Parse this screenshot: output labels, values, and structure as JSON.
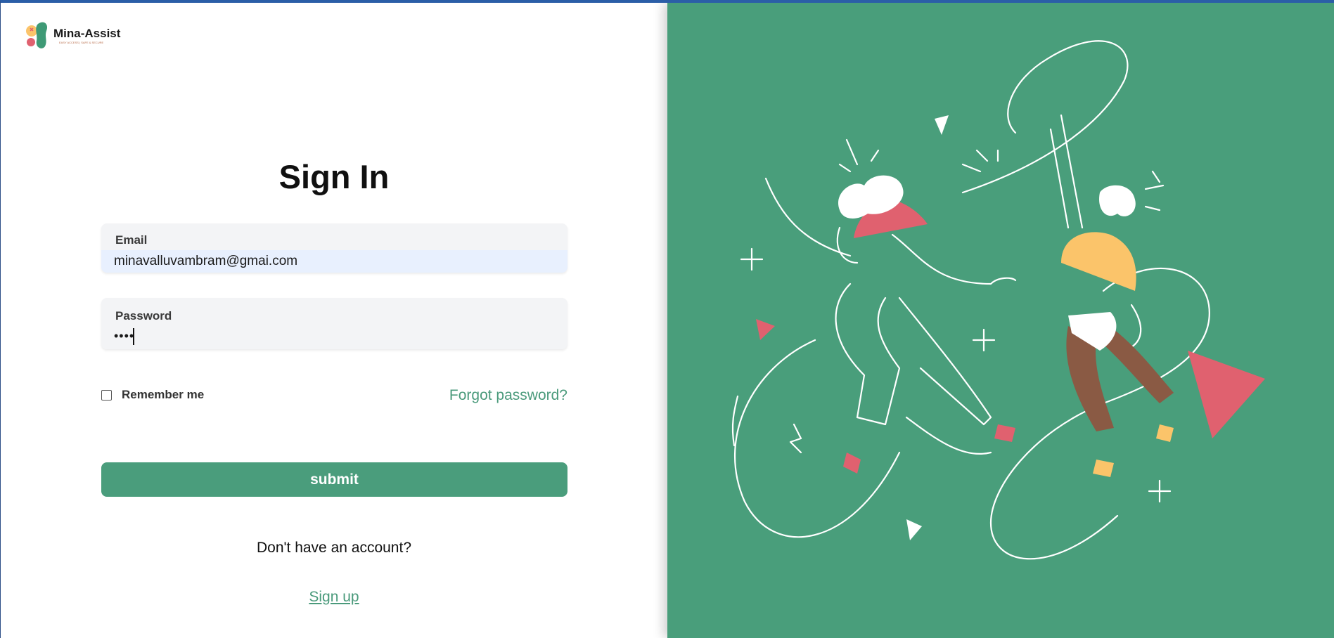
{
  "brand": {
    "name": "Mina-Assist",
    "tagline": "EASY ACCESS | SAFE & SECURE",
    "colors": {
      "accent": "#4a9d7c",
      "panel": "#499e7b",
      "pink": "#e0616f",
      "yellow": "#fbc46a",
      "brown": "#8a5a44"
    }
  },
  "form": {
    "title": "Sign In",
    "email": {
      "label": "Email",
      "value": "minavalluvambram@gmai.com"
    },
    "password": {
      "label": "Password",
      "masked_value": "••••"
    },
    "remember_me": {
      "label": "Remember me",
      "checked": false
    },
    "forgot_password": "Forgot password?",
    "submit": "submit",
    "no_account_text": "Don't have an account?",
    "signup_link": "Sign up"
  },
  "illustration": {
    "icon": "dancing-people-illustration"
  }
}
